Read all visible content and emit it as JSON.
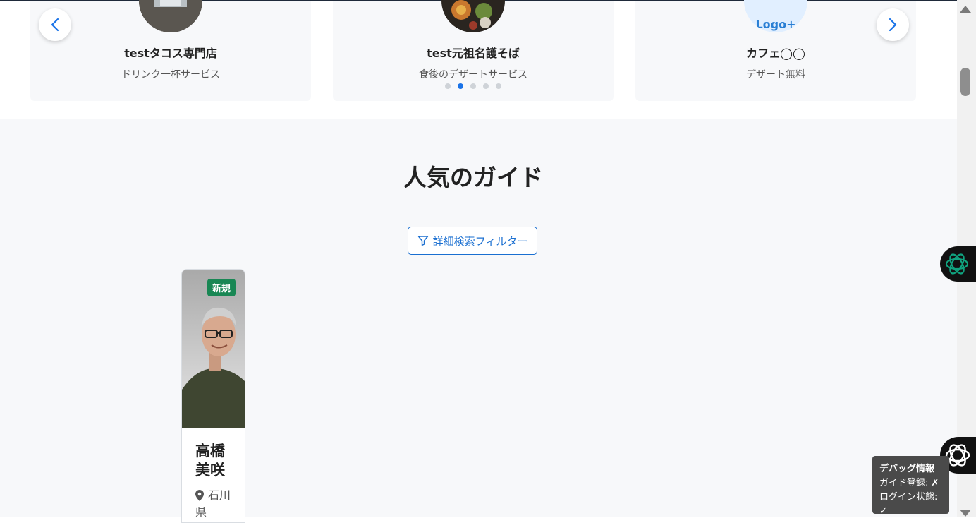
{
  "carousel": {
    "cards": [
      {
        "name": "testタコス専門店",
        "description": "ドリンク一杯サービス"
      },
      {
        "name": "test元祖名護そば",
        "description": "食後のデザートサービス"
      },
      {
        "name": "カフェ◯◯",
        "description": "デザート無料",
        "logo_text": "Logo+"
      }
    ],
    "dots_count": 5,
    "active_dot": 2
  },
  "section": {
    "title": "人気のガイド",
    "filter_label": "詳細検索フィルター"
  },
  "guide": {
    "badge": "新規",
    "name": "高橋美咲",
    "location": "石川県"
  },
  "debug": {
    "title": "デバッグ情報",
    "guide_registered": "ガイド登録: ✗",
    "login_state": "ログイン状態: ✓"
  },
  "colors": {
    "accent": "#1a73e8",
    "badge": "#198754",
    "section_bg": "#f7f8fa"
  }
}
